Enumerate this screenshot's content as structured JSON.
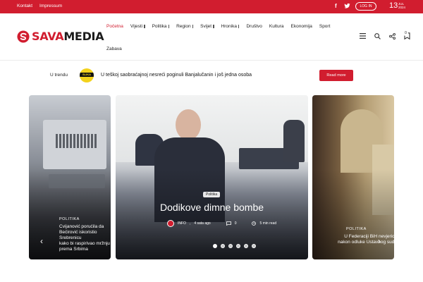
{
  "topbar": {
    "links": [
      "Kontakt",
      "Impressum"
    ],
    "login_label": "LOG IN",
    "date_day": "13",
    "date_month": "JUL",
    "date_year": "2024",
    "bg_color": "#d11d2f"
  },
  "brand": {
    "name_part1": "SAVA",
    "name_part2": "MEDIA",
    "accent_color": "#d11d2f"
  },
  "nav": {
    "items": [
      {
        "label": "Početna",
        "active": true,
        "has_submenu": false
      },
      {
        "label": "Vijesti",
        "has_submenu": true
      },
      {
        "label": "Politika",
        "has_submenu": true
      },
      {
        "label": "Region",
        "has_submenu": true
      },
      {
        "label": "Svijet",
        "has_submenu": true
      },
      {
        "label": "Hronika",
        "has_submenu": true
      },
      {
        "label": "Društvo",
        "has_submenu": false
      },
      {
        "label": "Kultura",
        "has_submenu": false
      },
      {
        "label": "Ekonomija",
        "has_submenu": false
      },
      {
        "label": "Sport",
        "has_submenu": false
      }
    ],
    "row2": [
      {
        "label": "Zabava"
      }
    ],
    "icons": [
      "menu-icon",
      "search-icon",
      "share-icon",
      "bookmark-icon"
    ],
    "bookmark_count": "0"
  },
  "trending": {
    "label": "U trendu",
    "thumb_text": "SLIKA",
    "headline": "U teškoj saobraćajnoj nesreći poginuli Banjalučanin i još jedna osoba",
    "button": "Read more"
  },
  "slider": {
    "left": {
      "category": "POLITIKA",
      "title_lines": [
        "Cvijanović porućila da",
        "Bećirović iskoristio Srebrenicu",
        "kako bi raspirivao mržnju",
        "prema Srbima"
      ]
    },
    "main": {
      "category": "Politika",
      "title": "Dodikove dimne bombe",
      "author": "INFO",
      "time": "4 sata ago",
      "comments": "0",
      "read_time": "5 min read"
    },
    "right": {
      "category": "POLITIKA",
      "title_lines": [
        "U Federaciji BiH nevjerica",
        "nakon odluke Ustavnog suda"
      ]
    },
    "dots_total": 6,
    "active_dot": 0
  }
}
